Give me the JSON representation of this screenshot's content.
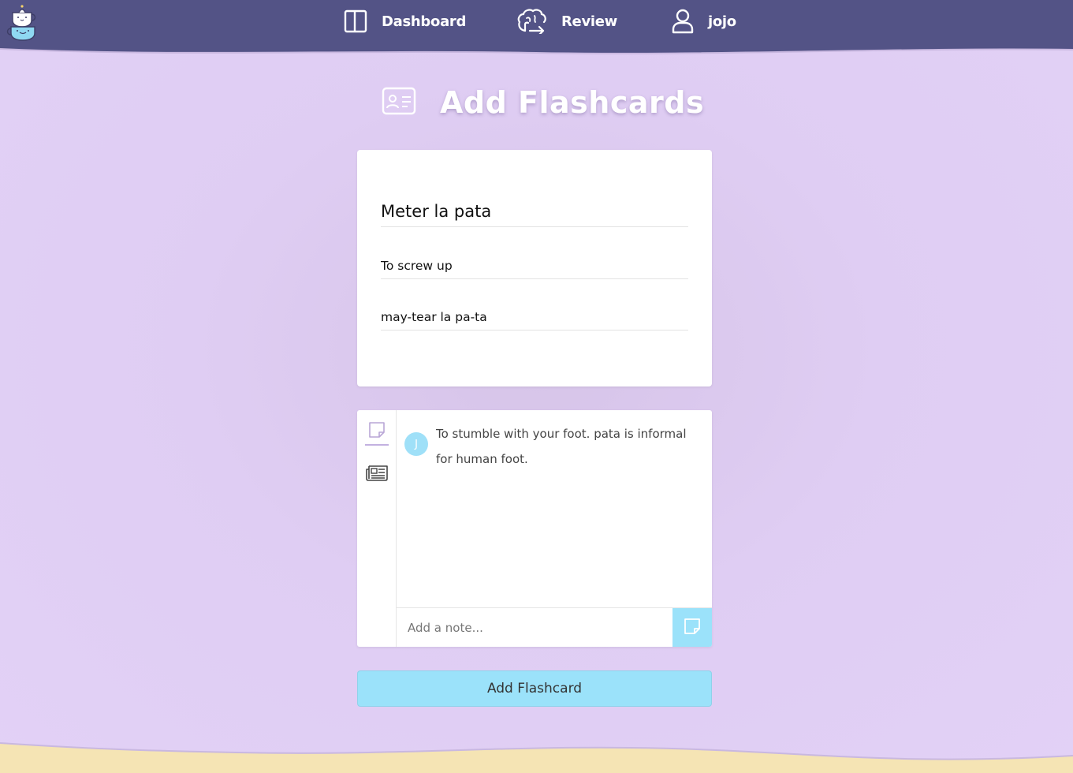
{
  "colors": {
    "navbar": "#535386",
    "background": "#e0cef4",
    "accent": "#9be2fa",
    "footer": "#f5e4b4"
  },
  "nav": {
    "logo_icon": "teacup-stack-logo",
    "items": [
      {
        "label": "Dashboard",
        "icon": "book-open-icon"
      },
      {
        "label": "Review",
        "icon": "brain-icon"
      },
      {
        "label": "jojo",
        "icon": "user-icon"
      }
    ]
  },
  "page": {
    "title": "Add Flashcards",
    "title_icon": "id-card-icon"
  },
  "card_form": {
    "front_value": "Meter la pata",
    "back_value": "To screw up",
    "pronunciation_value": "may-tear la pa-ta"
  },
  "notes": {
    "tabs": [
      {
        "icon": "sticky-note-icon",
        "active": true
      },
      {
        "icon": "newspaper-icon",
        "active": false
      }
    ],
    "items": [
      {
        "avatar_initial": "J",
        "text": "To stumble with your foot. pata is informal for human foot."
      }
    ],
    "input_placeholder": "Add a note...",
    "input_value": "",
    "submit_icon": "sticky-note-icon"
  },
  "submit": {
    "label": "Add Flashcard"
  }
}
